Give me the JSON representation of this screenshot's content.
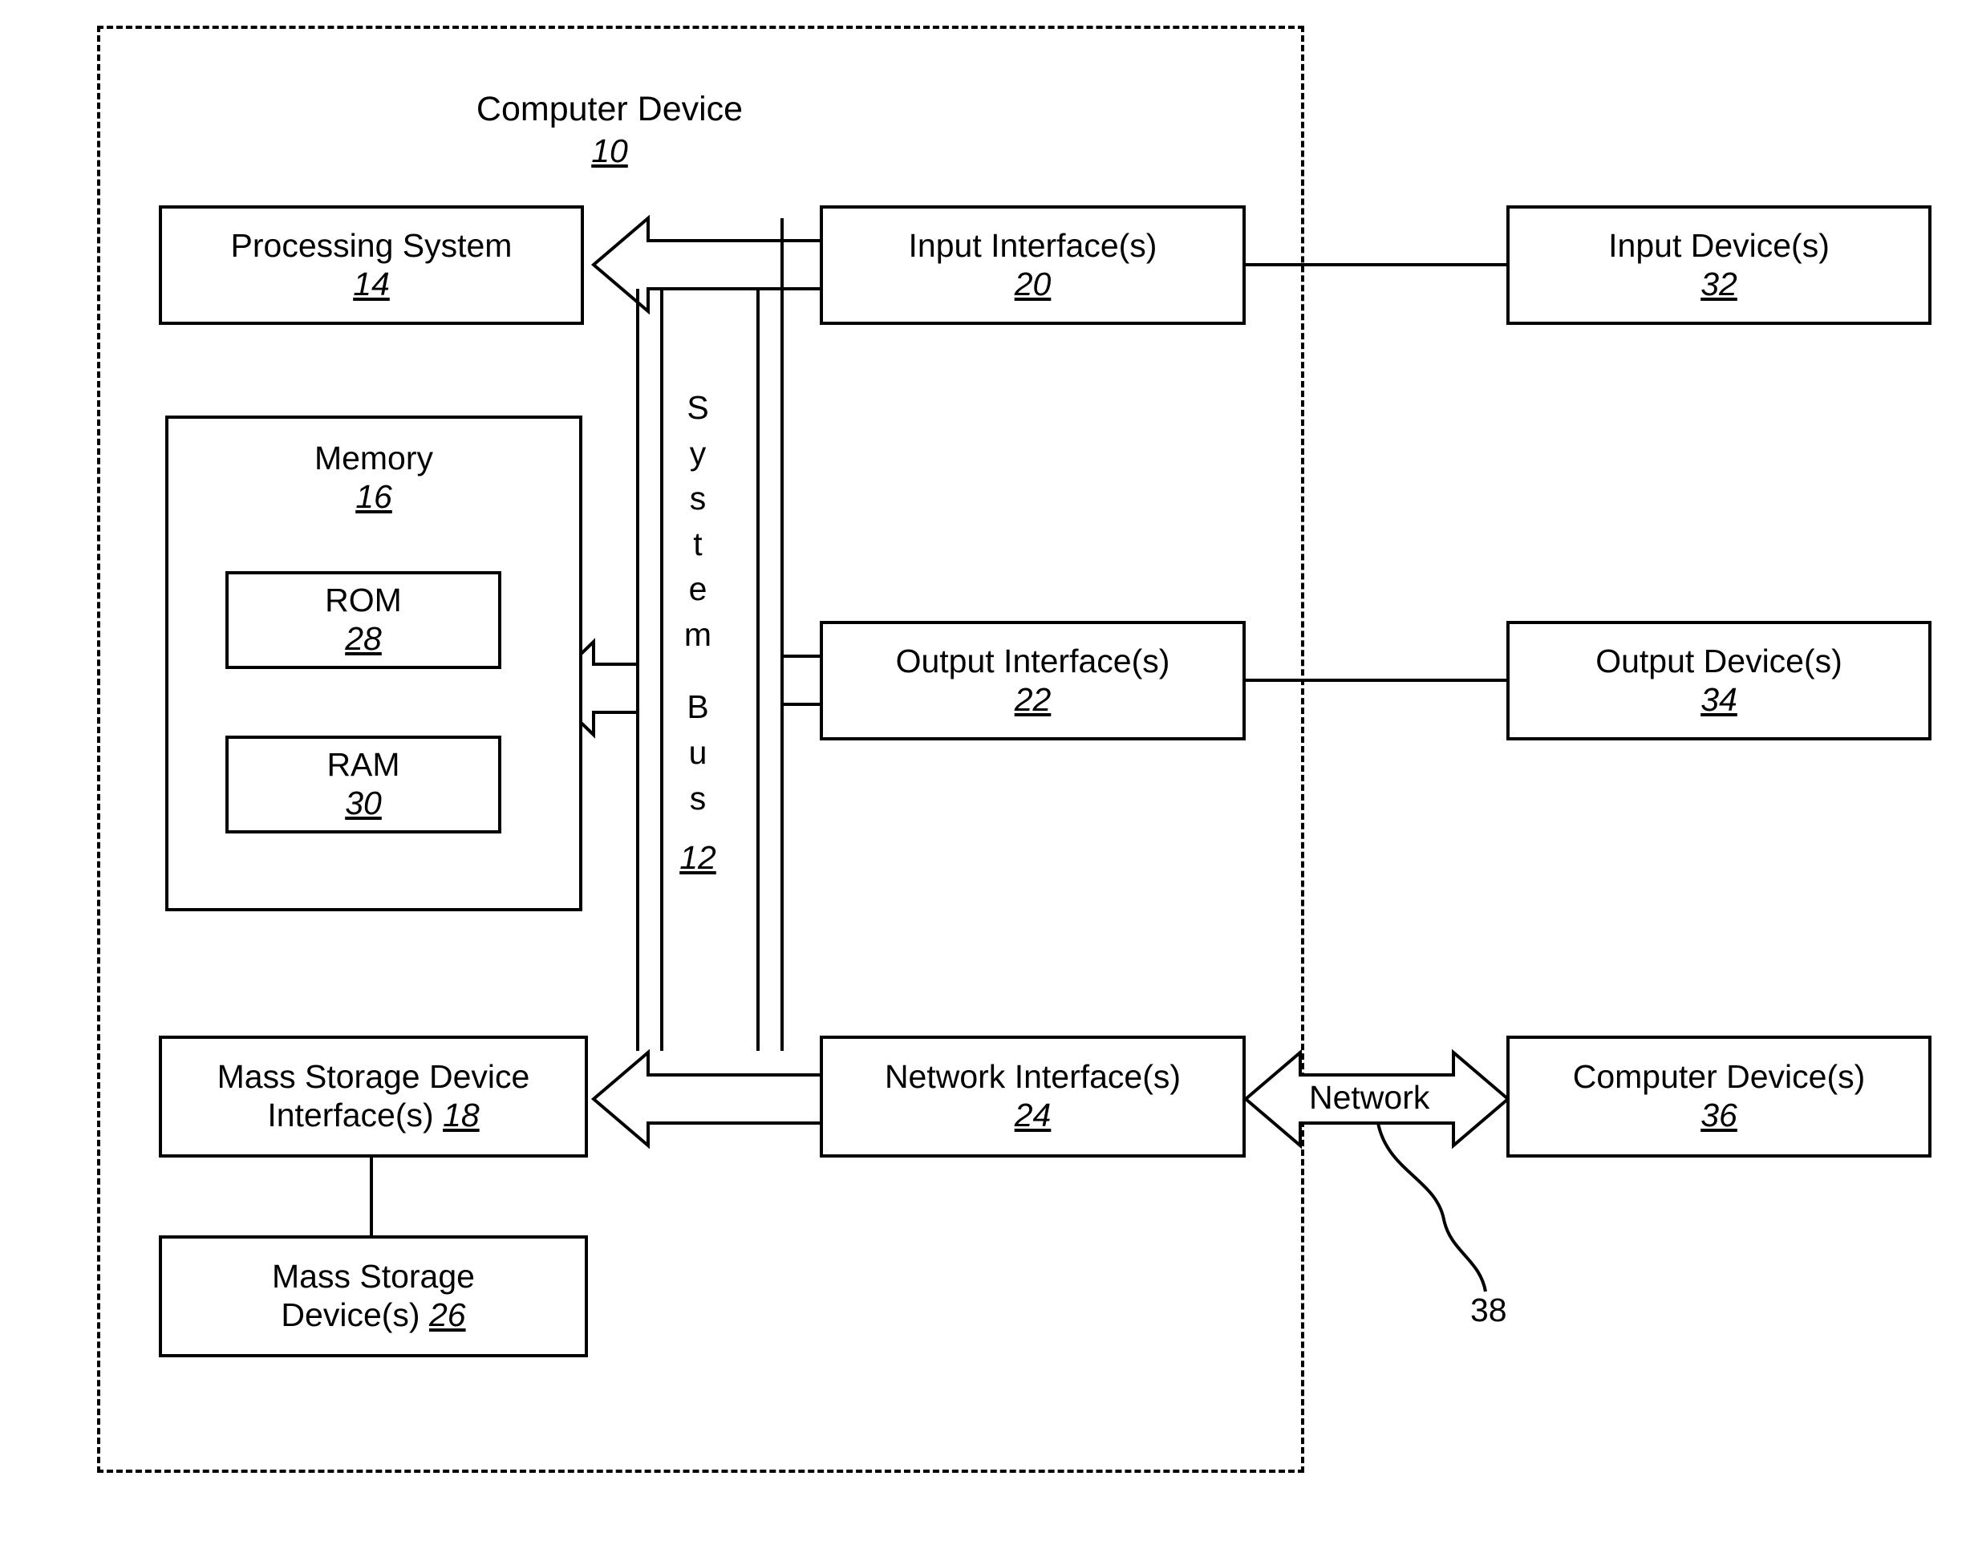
{
  "figure": {
    "title": "Computer Device",
    "title_ref": "10",
    "bus": {
      "label_letters": [
        "S",
        "y",
        "s",
        "t",
        "e",
        "m",
        "B",
        "u",
        "s"
      ],
      "label_text": "System Bus",
      "ref": "12"
    },
    "network_link": {
      "label": "Network",
      "ref": "38"
    }
  },
  "blocks": {
    "processing_system": {
      "title": "Processing System",
      "ref": "14"
    },
    "memory": {
      "title": "Memory",
      "ref": "16"
    },
    "rom": {
      "title": "ROM",
      "ref": "28"
    },
    "ram": {
      "title": "RAM",
      "ref": "30"
    },
    "mass_storage_interface": {
      "title_line1": "Mass Storage Device",
      "title_line2": "Interface(s)",
      "ref": "18"
    },
    "mass_storage_device": {
      "title_line1": "Mass Storage",
      "title_line2": "Device(s)",
      "ref": "26"
    },
    "input_interface": {
      "title": "Input Interface(s)",
      "ref": "20"
    },
    "output_interface": {
      "title": "Output Interface(s)",
      "ref": "22"
    },
    "network_interface": {
      "title": "Network Interface(s)",
      "ref": "24"
    },
    "input_device": {
      "title": "Input Device(s)",
      "ref": "32"
    },
    "output_device": {
      "title": "Output Device(s)",
      "ref": "34"
    },
    "computer_device": {
      "title": "Computer Device(s)",
      "ref": "36"
    }
  },
  "colors": {
    "stroke": "#000000",
    "background": "#ffffff"
  }
}
